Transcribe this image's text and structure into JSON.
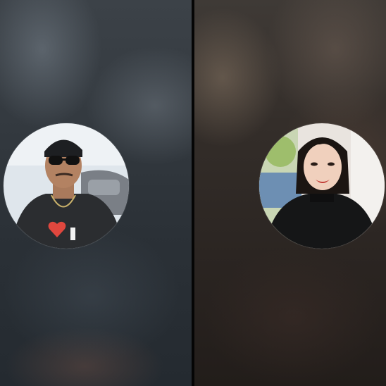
{
  "participants": [
    {
      "icon": "participant-avatar-icon"
    },
    {
      "icon": "participant-avatar-icon"
    }
  ]
}
